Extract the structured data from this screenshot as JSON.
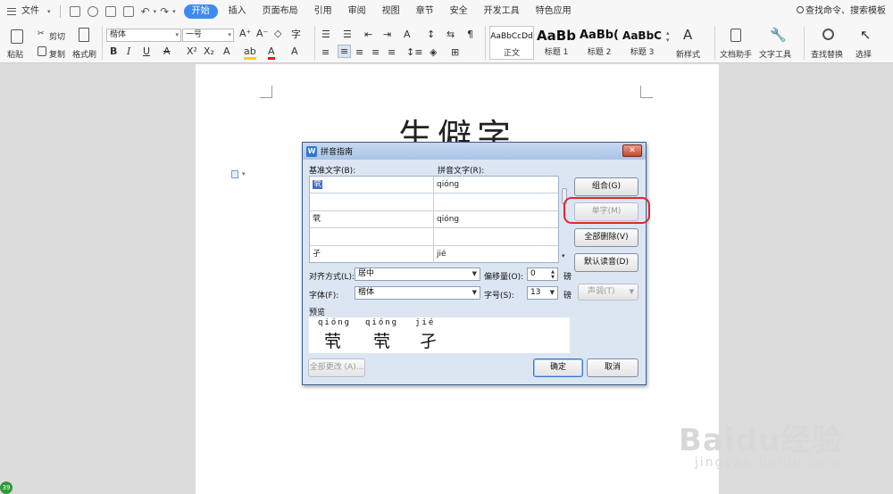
{
  "menubar": {
    "file_label": "文件",
    "tabs": [
      "开始",
      "插入",
      "页面布局",
      "引用",
      "审阅",
      "视图",
      "章节",
      "安全",
      "开发工具",
      "特色应用"
    ],
    "active_tab": "开始",
    "search_label": "查找命令、搜索模板"
  },
  "ribbon": {
    "paste": "粘贴",
    "cut": "剪切",
    "copy": "复制",
    "format_painter": "格式刷",
    "font_name": "楷体",
    "font_size": "一号",
    "bold": "B",
    "italic": "I",
    "underline": "U",
    "styles": [
      {
        "sample": "AaBbCcDd",
        "label": "正文"
      },
      {
        "sample": "AaBb",
        "label": "标题 1"
      },
      {
        "sample": "AaBb(",
        "label": "标题 2"
      },
      {
        "sample": "AaBbC",
        "label": "标题 3"
      }
    ],
    "new_style": "新样式",
    "doc_helper": "文档助手",
    "text_tools": "文字工具",
    "find_replace": "查找替换",
    "select": "选择"
  },
  "document": {
    "title": "生僻字"
  },
  "dialog": {
    "title": "拼音指南",
    "close_symbol": "✕",
    "base_text_header": "基准文字(B):",
    "ruby_text_header": "拼音文字(R):",
    "rows": [
      {
        "base": "茕",
        "ruby": "qióng",
        "selected": true
      },
      {
        "base": "",
        "ruby": ""
      },
      {
        "base": "茕",
        "ruby": "qióng"
      },
      {
        "base": "",
        "ruby": ""
      },
      {
        "base": "孑",
        "ruby": "jié"
      }
    ],
    "buttons": {
      "combine": "组合(G)",
      "single": "单字(M)",
      "delete_all": "全部删除(V)",
      "default_reading": "默认读音(D)",
      "tone": "声调(T)",
      "change_all": "全部更改 (A)...",
      "ok": "确定",
      "cancel": "取消"
    },
    "alignment_label": "对齐方式(L):",
    "alignment_value": "居中",
    "offset_label": "偏移量(O):",
    "offset_value": "0",
    "offset_unit": "磅",
    "font_label": "字体(F):",
    "font_value": "楷体",
    "size_label": "字号(S):",
    "size_value": "13",
    "size_unit": "磅",
    "preview_label": "预览",
    "preview_pinyin": [
      "qióng",
      "qióng",
      "jié"
    ],
    "preview_chars": [
      "茕",
      "茕",
      "孑"
    ]
  },
  "watermark": {
    "brand": "Baidu经验",
    "url": "jingyan.baidu.com"
  },
  "corner_badge": "39",
  "highlight_color": "#e0262c",
  "accent_color": "#3d8bf0"
}
